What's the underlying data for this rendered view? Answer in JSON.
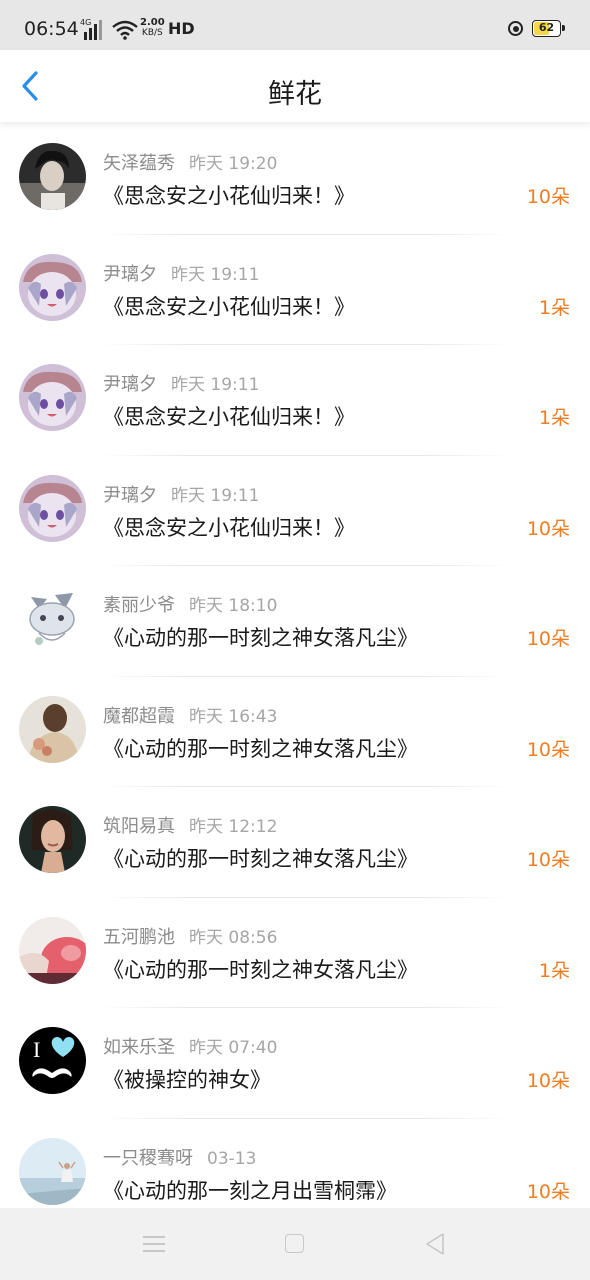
{
  "status_bar": {
    "time": "06:54",
    "network": "4G",
    "speed_value": "2.00",
    "speed_unit": "KB/S",
    "hd": "HD",
    "battery": "62",
    "battery_level": 0.62,
    "battery_color": "#f6d64a"
  },
  "header": {
    "title": "鲜花",
    "back_icon": "chevron-left-icon",
    "accent": "#2a8ee8"
  },
  "colors": {
    "count": "#ef7d24",
    "name": "#8c8c8c",
    "title": "#1a1a1a"
  },
  "records": [
    {
      "name": "矢泽蕴秀",
      "time": "昨天 19:20",
      "title": "《思念安之小花仙归来！》",
      "count": "10朵"
    },
    {
      "name": "尹璃夕",
      "time": "昨天 19:11",
      "title": "《思念安之小花仙归来！》",
      "count": "1朵"
    },
    {
      "name": "尹璃夕",
      "time": "昨天 19:11",
      "title": "《思念安之小花仙归来！》",
      "count": "1朵"
    },
    {
      "name": "尹璃夕",
      "time": "昨天 19:11",
      "title": "《思念安之小花仙归来！》",
      "count": "10朵"
    },
    {
      "name": "素丽少爷",
      "time": "昨天 18:10",
      "title": "《心动的那一时刻之神女落凡尘》",
      "count": "10朵"
    },
    {
      "name": "魔都超霞",
      "time": "昨天 16:43",
      "title": "《心动的那一时刻之神女落凡尘》",
      "count": "10朵"
    },
    {
      "name": "筑阳易真",
      "time": "昨天 12:12",
      "title": "《心动的那一时刻之神女落凡尘》",
      "count": "10朵"
    },
    {
      "name": "五河鹏池",
      "time": "昨天 08:56",
      "title": "《心动的那一时刻之神女落凡尘》",
      "count": "1朵"
    },
    {
      "name": "如来乐圣",
      "time": "昨天 07:40",
      "title": "《被操控的神女》",
      "count": "10朵"
    },
    {
      "name": "一只稷骞呀",
      "time": "03-13",
      "title": "《心动的那一刻之月出雪桐霈》",
      "count": "10朵"
    }
  ],
  "navbar": {
    "items": [
      "menu-icon",
      "home-icon",
      "back-triangle-icon"
    ]
  }
}
